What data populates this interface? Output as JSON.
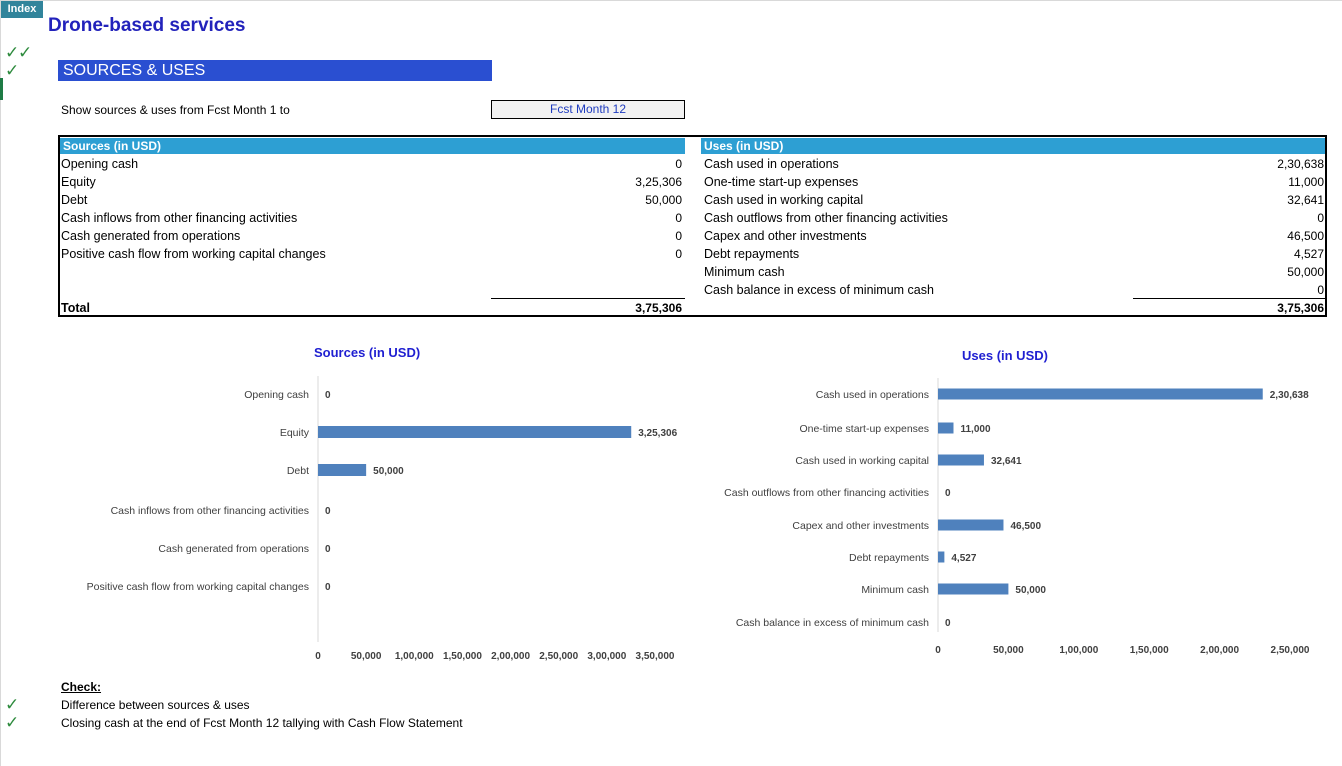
{
  "nav": {
    "index_label": "Index"
  },
  "page": {
    "title": "Drone-based services",
    "section_title": "SOURCES & USES",
    "period_label": "Show sources & uses from Fcst Month 1 to",
    "period_value": "Fcst Month 12",
    "check_icon": "✓",
    "check_color": "#2e8b3e",
    "accent_color": "#2a4fd1",
    "header_color": "#2d9fd3",
    "bar_color": "#4f81bd"
  },
  "sources": {
    "header": "Sources (in USD)",
    "rows": [
      {
        "label": "Opening cash",
        "value": "0"
      },
      {
        "label": "Equity",
        "value": "3,25,306"
      },
      {
        "label": "Debt",
        "value": "50,000"
      },
      {
        "label": "Cash inflows from other financing activities",
        "value": "0"
      },
      {
        "label": "Cash generated from operations",
        "value": "0"
      },
      {
        "label": "Positive cash flow from working capital changes",
        "value": "0"
      }
    ],
    "total_label": "Total",
    "total_value": "3,75,306"
  },
  "uses": {
    "header": "Uses (in USD)",
    "rows": [
      {
        "label": "Cash used in operations",
        "value": "2,30,638"
      },
      {
        "label": "One-time start-up expenses",
        "value": "11,000"
      },
      {
        "label": "Cash used in working capital",
        "value": "32,641"
      },
      {
        "label": "Cash outflows from other  financing activities",
        "value": "0"
      },
      {
        "label": "Capex and other investments",
        "value": "46,500"
      },
      {
        "label": "Debt repayments",
        "value": "4,527"
      },
      {
        "label": "Minimum cash",
        "value": "50,000"
      },
      {
        "label": "Cash balance in excess of minimum cash",
        "value": "0"
      }
    ],
    "total_value": "3,75,306"
  },
  "chart_data": [
    {
      "type": "bar",
      "orientation": "horizontal",
      "title": "Sources (in USD)",
      "categories": [
        "Opening cash",
        "Equity",
        "Debt",
        "Cash inflows from other financing activities",
        "Cash generated from operations",
        "Positive cash flow from working capital changes"
      ],
      "values": [
        0,
        325306,
        50000,
        0,
        0,
        0
      ],
      "value_labels": [
        "0",
        "3,25,306",
        "50,000",
        "0",
        "0",
        "0"
      ],
      "xlim": [
        0,
        350000
      ],
      "ticks": [
        0,
        50000,
        100000,
        150000,
        200000,
        250000,
        300000,
        350000
      ],
      "tick_labels": [
        "0",
        "50,000",
        "1,00,000",
        "1,50,000",
        "2,00,000",
        "2,50,000",
        "3,00,000",
        "3,50,000"
      ],
      "grid": false,
      "legend": "none"
    },
    {
      "type": "bar",
      "orientation": "horizontal",
      "title": "Uses (in USD)",
      "categories": [
        "Cash used in operations",
        "One-time start-up expenses",
        "Cash used in working capital",
        "Cash outflows from other  financing activities",
        "Capex and other investments",
        "Debt repayments",
        "Minimum cash",
        "Cash balance in excess of minimum cash"
      ],
      "values": [
        230638,
        11000,
        32641,
        0,
        46500,
        4527,
        50000,
        0
      ],
      "value_labels": [
        "2,30,638",
        "11,000",
        "32,641",
        "0",
        "46,500",
        "4,527",
        "50,000",
        "0"
      ],
      "xlim": [
        0,
        250000
      ],
      "ticks": [
        0,
        50000,
        100000,
        150000,
        200000,
        250000
      ],
      "tick_labels": [
        "0",
        "50,000",
        "1,00,000",
        "1,50,000",
        "2,00,000",
        "2,50,000"
      ],
      "grid": false,
      "legend": "none"
    }
  ],
  "checks": {
    "heading": "Check:",
    "items": [
      "Difference between sources & uses",
      "Closing cash at the end of Fcst Month 12 tallying with Cash Flow Statement"
    ]
  }
}
